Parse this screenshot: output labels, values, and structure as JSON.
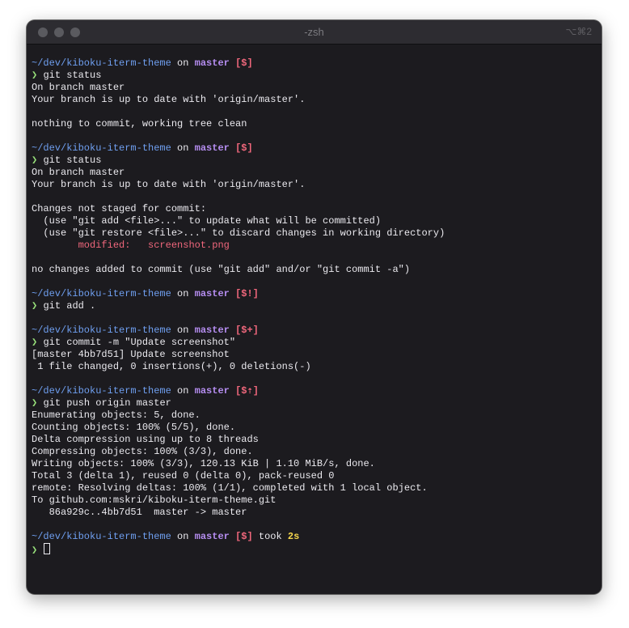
{
  "window": {
    "title": "-zsh",
    "shortcut": "⌥⌘2"
  },
  "prompt": {
    "path": "~/dev/kiboku-iterm-theme",
    "on": "on",
    "branch": "master",
    "arrow": "❯"
  },
  "blocks": {
    "b1": {
      "status": "[$]",
      "command": "git status",
      "out1": "On branch master",
      "out2": "Your branch is up to date with 'origin/master'.",
      "out3": "nothing to commit, working tree clean"
    },
    "b2": {
      "status": "[$]",
      "command": "git status",
      "out1": "On branch master",
      "out2": "Your branch is up to date with 'origin/master'.",
      "out3": "Changes not staged for commit:",
      "out4": "  (use \"git add <file>...\" to update what will be committed)",
      "out5": "  (use \"git restore <file>...\" to discard changes in working directory)",
      "modified_label": "        modified:   ",
      "modified_file": "screenshot.png",
      "out6": "no changes added to commit (use \"git add\" and/or \"git commit -a\")"
    },
    "b3": {
      "status": "[$!]",
      "command": "git add ."
    },
    "b4": {
      "status": "[$+]",
      "command": "git commit -m \"Update screenshot\"",
      "out1": "[master 4bb7d51] Update screenshot",
      "out2": " 1 file changed, 0 insertions(+), 0 deletions(-)"
    },
    "b5": {
      "status": "[$⇡]",
      "command": "git push origin master",
      "out1": "Enumerating objects: 5, done.",
      "out2": "Counting objects: 100% (5/5), done.",
      "out3": "Delta compression using up to 8 threads",
      "out4": "Compressing objects: 100% (3/3), done.",
      "out5": "Writing objects: 100% (3/3), 120.13 KiB | 1.10 MiB/s, done.",
      "out6": "Total 3 (delta 1), reused 0 (delta 0), pack-reused 0",
      "out7": "remote: Resolving deltas: 100% (1/1), completed with 1 local object.",
      "out8": "To github.com:mskri/kiboku-iterm-theme.git",
      "out9": "   86a929c..4bb7d51  master -> master"
    },
    "b6": {
      "status": "[$]",
      "took": "took",
      "duration": "2s"
    }
  },
  "colors": {
    "background": "#1c1b1f",
    "path": "#6f9ff0",
    "branch": "#b58df0",
    "status": "#f0677c",
    "arrow": "#97e07a",
    "duration": "#f4d54c",
    "text": "#ebeaef"
  }
}
